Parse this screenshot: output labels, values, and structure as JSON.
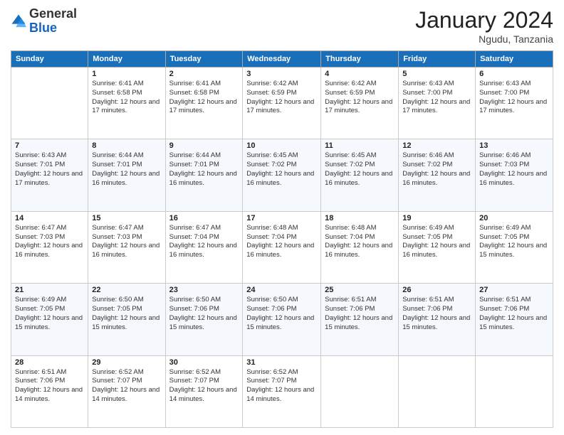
{
  "header": {
    "logo_general": "General",
    "logo_blue": "Blue",
    "month_year": "January 2024",
    "location": "Ngudu, Tanzania"
  },
  "days_of_week": [
    "Sunday",
    "Monday",
    "Tuesday",
    "Wednesday",
    "Thursday",
    "Friday",
    "Saturday"
  ],
  "weeks": [
    [
      {
        "day": "",
        "sunrise": "",
        "sunset": "",
        "daylight": ""
      },
      {
        "day": "1",
        "sunrise": "Sunrise: 6:41 AM",
        "sunset": "Sunset: 6:58 PM",
        "daylight": "Daylight: 12 hours and 17 minutes."
      },
      {
        "day": "2",
        "sunrise": "Sunrise: 6:41 AM",
        "sunset": "Sunset: 6:58 PM",
        "daylight": "Daylight: 12 hours and 17 minutes."
      },
      {
        "day": "3",
        "sunrise": "Sunrise: 6:42 AM",
        "sunset": "Sunset: 6:59 PM",
        "daylight": "Daylight: 12 hours and 17 minutes."
      },
      {
        "day": "4",
        "sunrise": "Sunrise: 6:42 AM",
        "sunset": "Sunset: 6:59 PM",
        "daylight": "Daylight: 12 hours and 17 minutes."
      },
      {
        "day": "5",
        "sunrise": "Sunrise: 6:43 AM",
        "sunset": "Sunset: 7:00 PM",
        "daylight": "Daylight: 12 hours and 17 minutes."
      },
      {
        "day": "6",
        "sunrise": "Sunrise: 6:43 AM",
        "sunset": "Sunset: 7:00 PM",
        "daylight": "Daylight: 12 hours and 17 minutes."
      }
    ],
    [
      {
        "day": "7",
        "sunrise": "Sunrise: 6:43 AM",
        "sunset": "Sunset: 7:01 PM",
        "daylight": "Daylight: 12 hours and 17 minutes."
      },
      {
        "day": "8",
        "sunrise": "Sunrise: 6:44 AM",
        "sunset": "Sunset: 7:01 PM",
        "daylight": "Daylight: 12 hours and 16 minutes."
      },
      {
        "day": "9",
        "sunrise": "Sunrise: 6:44 AM",
        "sunset": "Sunset: 7:01 PM",
        "daylight": "Daylight: 12 hours and 16 minutes."
      },
      {
        "day": "10",
        "sunrise": "Sunrise: 6:45 AM",
        "sunset": "Sunset: 7:02 PM",
        "daylight": "Daylight: 12 hours and 16 minutes."
      },
      {
        "day": "11",
        "sunrise": "Sunrise: 6:45 AM",
        "sunset": "Sunset: 7:02 PM",
        "daylight": "Daylight: 12 hours and 16 minutes."
      },
      {
        "day": "12",
        "sunrise": "Sunrise: 6:46 AM",
        "sunset": "Sunset: 7:02 PM",
        "daylight": "Daylight: 12 hours and 16 minutes."
      },
      {
        "day": "13",
        "sunrise": "Sunrise: 6:46 AM",
        "sunset": "Sunset: 7:03 PM",
        "daylight": "Daylight: 12 hours and 16 minutes."
      }
    ],
    [
      {
        "day": "14",
        "sunrise": "Sunrise: 6:47 AM",
        "sunset": "Sunset: 7:03 PM",
        "daylight": "Daylight: 12 hours and 16 minutes."
      },
      {
        "day": "15",
        "sunrise": "Sunrise: 6:47 AM",
        "sunset": "Sunset: 7:03 PM",
        "daylight": "Daylight: 12 hours and 16 minutes."
      },
      {
        "day": "16",
        "sunrise": "Sunrise: 6:47 AM",
        "sunset": "Sunset: 7:04 PM",
        "daylight": "Daylight: 12 hours and 16 minutes."
      },
      {
        "day": "17",
        "sunrise": "Sunrise: 6:48 AM",
        "sunset": "Sunset: 7:04 PM",
        "daylight": "Daylight: 12 hours and 16 minutes."
      },
      {
        "day": "18",
        "sunrise": "Sunrise: 6:48 AM",
        "sunset": "Sunset: 7:04 PM",
        "daylight": "Daylight: 12 hours and 16 minutes."
      },
      {
        "day": "19",
        "sunrise": "Sunrise: 6:49 AM",
        "sunset": "Sunset: 7:05 PM",
        "daylight": "Daylight: 12 hours and 16 minutes."
      },
      {
        "day": "20",
        "sunrise": "Sunrise: 6:49 AM",
        "sunset": "Sunset: 7:05 PM",
        "daylight": "Daylight: 12 hours and 15 minutes."
      }
    ],
    [
      {
        "day": "21",
        "sunrise": "Sunrise: 6:49 AM",
        "sunset": "Sunset: 7:05 PM",
        "daylight": "Daylight: 12 hours and 15 minutes."
      },
      {
        "day": "22",
        "sunrise": "Sunrise: 6:50 AM",
        "sunset": "Sunset: 7:05 PM",
        "daylight": "Daylight: 12 hours and 15 minutes."
      },
      {
        "day": "23",
        "sunrise": "Sunrise: 6:50 AM",
        "sunset": "Sunset: 7:06 PM",
        "daylight": "Daylight: 12 hours and 15 minutes."
      },
      {
        "day": "24",
        "sunrise": "Sunrise: 6:50 AM",
        "sunset": "Sunset: 7:06 PM",
        "daylight": "Daylight: 12 hours and 15 minutes."
      },
      {
        "day": "25",
        "sunrise": "Sunrise: 6:51 AM",
        "sunset": "Sunset: 7:06 PM",
        "daylight": "Daylight: 12 hours and 15 minutes."
      },
      {
        "day": "26",
        "sunrise": "Sunrise: 6:51 AM",
        "sunset": "Sunset: 7:06 PM",
        "daylight": "Daylight: 12 hours and 15 minutes."
      },
      {
        "day": "27",
        "sunrise": "Sunrise: 6:51 AM",
        "sunset": "Sunset: 7:06 PM",
        "daylight": "Daylight: 12 hours and 15 minutes."
      }
    ],
    [
      {
        "day": "28",
        "sunrise": "Sunrise: 6:51 AM",
        "sunset": "Sunset: 7:06 PM",
        "daylight": "Daylight: 12 hours and 14 minutes."
      },
      {
        "day": "29",
        "sunrise": "Sunrise: 6:52 AM",
        "sunset": "Sunset: 7:07 PM",
        "daylight": "Daylight: 12 hours and 14 minutes."
      },
      {
        "day": "30",
        "sunrise": "Sunrise: 6:52 AM",
        "sunset": "Sunset: 7:07 PM",
        "daylight": "Daylight: 12 hours and 14 minutes."
      },
      {
        "day": "31",
        "sunrise": "Sunrise: 6:52 AM",
        "sunset": "Sunset: 7:07 PM",
        "daylight": "Daylight: 12 hours and 14 minutes."
      },
      {
        "day": "",
        "sunrise": "",
        "sunset": "",
        "daylight": ""
      },
      {
        "day": "",
        "sunrise": "",
        "sunset": "",
        "daylight": ""
      },
      {
        "day": "",
        "sunrise": "",
        "sunset": "",
        "daylight": ""
      }
    ]
  ]
}
